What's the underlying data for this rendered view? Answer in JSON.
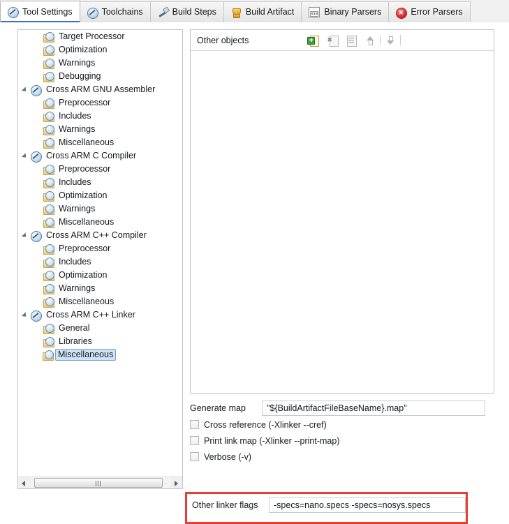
{
  "tabs": [
    {
      "label": "Tool Settings",
      "icon": "tool-icon",
      "selected": true
    },
    {
      "label": "Toolchains",
      "icon": "tool-icon",
      "selected": false
    },
    {
      "label": "Build Steps",
      "icon": "hammer-icon",
      "selected": false
    },
    {
      "label": "Build Artifact",
      "icon": "trophy-icon",
      "selected": false
    },
    {
      "label": "Binary Parsers",
      "icon": "binary-file-icon",
      "selected": false
    },
    {
      "label": "Error Parsers",
      "icon": "error-circle-icon",
      "selected": false
    }
  ],
  "tree": {
    "items": [
      {
        "label": "Target Processor",
        "indent": 1,
        "icon": "folder-tool-icon",
        "expandable": false,
        "selected": false
      },
      {
        "label": "Optimization",
        "indent": 1,
        "icon": "folder-tool-icon",
        "expandable": false,
        "selected": false
      },
      {
        "label": "Warnings",
        "indent": 1,
        "icon": "folder-tool-icon",
        "expandable": false,
        "selected": false
      },
      {
        "label": "Debugging",
        "indent": 1,
        "icon": "folder-tool-icon",
        "expandable": false,
        "selected": false
      },
      {
        "label": "Cross ARM GNU Assembler",
        "indent": 0,
        "icon": "tool-circle-icon",
        "expandable": true,
        "selected": false
      },
      {
        "label": "Preprocessor",
        "indent": 1,
        "icon": "folder-tool-icon",
        "expandable": false,
        "selected": false
      },
      {
        "label": "Includes",
        "indent": 1,
        "icon": "folder-tool-icon",
        "expandable": false,
        "selected": false
      },
      {
        "label": "Warnings",
        "indent": 1,
        "icon": "folder-tool-icon",
        "expandable": false,
        "selected": false
      },
      {
        "label": "Miscellaneous",
        "indent": 1,
        "icon": "folder-tool-icon",
        "expandable": false,
        "selected": false
      },
      {
        "label": "Cross ARM C Compiler",
        "indent": 0,
        "icon": "tool-circle-icon",
        "expandable": true,
        "selected": false
      },
      {
        "label": "Preprocessor",
        "indent": 1,
        "icon": "folder-tool-icon",
        "expandable": false,
        "selected": false
      },
      {
        "label": "Includes",
        "indent": 1,
        "icon": "folder-tool-icon",
        "expandable": false,
        "selected": false
      },
      {
        "label": "Optimization",
        "indent": 1,
        "icon": "folder-tool-icon",
        "expandable": false,
        "selected": false
      },
      {
        "label": "Warnings",
        "indent": 1,
        "icon": "folder-tool-icon",
        "expandable": false,
        "selected": false
      },
      {
        "label": "Miscellaneous",
        "indent": 1,
        "icon": "folder-tool-icon",
        "expandable": false,
        "selected": false
      },
      {
        "label": "Cross ARM C++ Compiler",
        "indent": 0,
        "icon": "tool-circle-icon",
        "expandable": true,
        "selected": false
      },
      {
        "label": "Preprocessor",
        "indent": 1,
        "icon": "folder-tool-icon",
        "expandable": false,
        "selected": false
      },
      {
        "label": "Includes",
        "indent": 1,
        "icon": "folder-tool-icon",
        "expandable": false,
        "selected": false
      },
      {
        "label": "Optimization",
        "indent": 1,
        "icon": "folder-tool-icon",
        "expandable": false,
        "selected": false
      },
      {
        "label": "Warnings",
        "indent": 1,
        "icon": "folder-tool-icon",
        "expandable": false,
        "selected": false
      },
      {
        "label": "Miscellaneous",
        "indent": 1,
        "icon": "folder-tool-icon",
        "expandable": false,
        "selected": false
      },
      {
        "label": "Cross ARM C++ Linker",
        "indent": 0,
        "icon": "tool-circle-icon",
        "expandable": true,
        "selected": false
      },
      {
        "label": "General",
        "indent": 1,
        "icon": "folder-tool-icon",
        "expandable": false,
        "selected": false
      },
      {
        "label": "Libraries",
        "indent": 1,
        "icon": "folder-tool-icon",
        "expandable": false,
        "selected": false
      },
      {
        "label": "Miscellaneous",
        "indent": 1,
        "icon": "folder-tool-icon",
        "expandable": false,
        "selected": true
      }
    ],
    "scrollbar": {
      "left_arrow": "◀",
      "right_arrow": "▶"
    }
  },
  "list_panel": {
    "title": "Other objects",
    "tools": [
      {
        "name": "add-button",
        "enabled": true
      },
      {
        "name": "delete-button",
        "enabled": false
      },
      {
        "name": "edit-button",
        "enabled": false
      },
      {
        "name": "move-up-button",
        "enabled": false
      },
      {
        "name": "move-down-button",
        "enabled": false
      }
    ],
    "items": []
  },
  "form": {
    "generate_map": {
      "label": "Generate map",
      "value": "\"${BuildArtifactFileBaseName}.map\""
    },
    "checkboxes": [
      {
        "label": "Cross reference (-Xlinker --cref)",
        "checked": false
      },
      {
        "label": "Print link map (-Xlinker --print-map)",
        "checked": false
      },
      {
        "label": "Verbose (-v)",
        "checked": false
      }
    ],
    "other_linker_flags": {
      "label": "Other linker flags",
      "value": "-specs=nano.specs -specs=nosys.specs"
    }
  },
  "highlight": {
    "color": "#eb3c33",
    "target": "other-linker-flags-row"
  }
}
